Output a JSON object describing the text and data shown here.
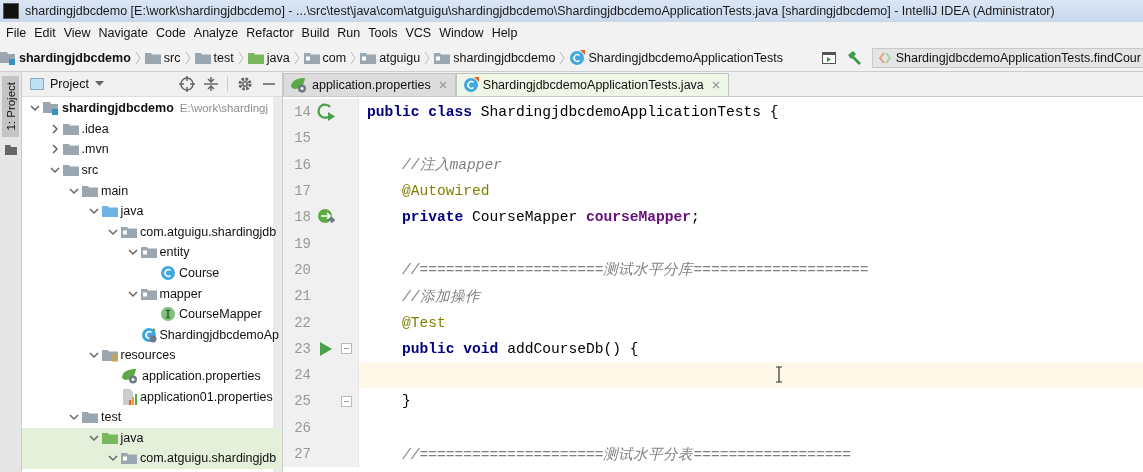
{
  "window": {
    "title": "shardingjdbcdemo [E:\\work\\shardingjdbcdemo] - ...\\src\\test\\java\\com\\atguigu\\shardingjdbcdemo\\ShardingjdbcdemoApplicationTests.java [shardingjdbcdemo] - IntelliJ IDEA (Administrator)"
  },
  "menu": [
    "File",
    "Edit",
    "View",
    "Navigate",
    "Code",
    "Analyze",
    "Refactor",
    "Build",
    "Run",
    "Tools",
    "VCS",
    "Window",
    "Help"
  ],
  "breadcrumbs": [
    {
      "label": "shardingjdbcdemo",
      "kind": "module"
    },
    {
      "label": "src",
      "kind": "folder"
    },
    {
      "label": "test",
      "kind": "folder"
    },
    {
      "label": "java",
      "kind": "test-root"
    },
    {
      "label": "com",
      "kind": "package"
    },
    {
      "label": "atguigu",
      "kind": "package"
    },
    {
      "label": "shardingjdbcdemo",
      "kind": "package"
    },
    {
      "label": "ShardingjdbcdemoApplicationTests",
      "kind": "test-class"
    }
  ],
  "run_config": {
    "label": "ShardingjdbcdemoApplicationTests.findCour"
  },
  "side_strip": {
    "label": "1: Project"
  },
  "project_panel": {
    "title": "Project",
    "tree": [
      {
        "label": "shardingjdbcdemo",
        "path": "E:\\work\\shardingj",
        "kind": "module",
        "expanded": true,
        "highlighted": false,
        "children": [
          {
            "label": ".idea",
            "kind": "folder",
            "expanded": false,
            "highlighted": false
          },
          {
            "label": ".mvn",
            "kind": "folder",
            "expanded": false,
            "highlighted": false
          },
          {
            "label": "src",
            "kind": "folder",
            "expanded": true,
            "highlighted": false,
            "children": [
              {
                "label": "main",
                "kind": "folder",
                "expanded": true,
                "highlighted": false,
                "children": [
                  {
                    "label": "java",
                    "kind": "source-root",
                    "expanded": true,
                    "highlighted": false,
                    "children": [
                      {
                        "label": "com.atguigu.shardingjdb",
                        "kind": "package",
                        "expanded": true,
                        "highlighted": false,
                        "children": [
                          {
                            "label": "entity",
                            "kind": "package",
                            "expanded": true,
                            "highlighted": false,
                            "children": [
                              {
                                "label": "Course",
                                "kind": "class",
                                "highlighted": false
                              }
                            ]
                          },
                          {
                            "label": "mapper",
                            "kind": "package",
                            "expanded": true,
                            "highlighted": false,
                            "children": [
                              {
                                "label": "CourseMapper",
                                "kind": "interface",
                                "highlighted": false
                              }
                            ]
                          },
                          {
                            "label": "ShardingjdbcdemoAp",
                            "kind": "spring-class",
                            "highlighted": false
                          }
                        ]
                      }
                    ]
                  },
                  {
                    "label": "resources",
                    "kind": "resources-root",
                    "expanded": true,
                    "highlighted": false,
                    "children": [
                      {
                        "label": "application.properties",
                        "kind": "spring-properties",
                        "highlighted": false
                      },
                      {
                        "label": "application01.properties",
                        "kind": "properties",
                        "highlighted": false
                      }
                    ]
                  }
                ]
              },
              {
                "label": "test",
                "kind": "folder",
                "expanded": true,
                "highlighted": false,
                "children": [
                  {
                    "label": "java",
                    "kind": "test-root",
                    "expanded": true,
                    "highlighted": true,
                    "children": [
                      {
                        "label": "com.atguigu.shardingjdb",
                        "kind": "package",
                        "expanded": true,
                        "highlighted": true
                      }
                    ]
                  }
                ]
              }
            ]
          }
        ]
      }
    ]
  },
  "editor": {
    "tabs": [
      {
        "label": "application.properties",
        "kind": "spring-properties",
        "selected": false
      },
      {
        "label": "ShardingjdbcdemoApplicationTests.java",
        "kind": "test-class",
        "selected": true
      }
    ],
    "lines": [
      {
        "number": "14",
        "kind": "run-class",
        "current": false,
        "tokens": [
          {
            "kind": "keyword",
            "text": "public class "
          },
          {
            "kind": "plain",
            "text": "ShardingjdbcdemoApplicationTests {"
          }
        ]
      },
      {
        "number": "15",
        "current": false
      },
      {
        "number": "16",
        "current": false,
        "tokens": [
          {
            "kind": "comment",
            "text": "    //注入mapper"
          }
        ]
      },
      {
        "number": "17",
        "current": false,
        "tokens": [
          {
            "kind": "annotation",
            "text": "    @Autowired"
          }
        ]
      },
      {
        "number": "18",
        "kind": "bean",
        "current": false,
        "tokens": [
          {
            "kind": "keyword",
            "text": "    private "
          },
          {
            "kind": "plain",
            "text": "CourseMapper "
          },
          {
            "kind": "field",
            "text": "courseMapper"
          },
          {
            "kind": "plain",
            "text": ";"
          }
        ]
      },
      {
        "number": "19",
        "current": false
      },
      {
        "number": "20",
        "current": false,
        "tokens": [
          {
            "kind": "comment",
            "text": "    //=====================测试水平分库===================="
          }
        ]
      },
      {
        "number": "21",
        "current": false,
        "tokens": [
          {
            "kind": "comment",
            "text": "    //添加操作"
          }
        ]
      },
      {
        "number": "22",
        "current": false,
        "tokens": [
          {
            "kind": "annotation",
            "text": "    @Test"
          }
        ]
      },
      {
        "number": "23",
        "kind": "run-method",
        "fold": true,
        "current": false,
        "tokens": [
          {
            "kind": "keyword",
            "text": "    public void "
          },
          {
            "kind": "plain",
            "text": "addCourseDb() {"
          }
        ]
      },
      {
        "number": "24",
        "current": true
      },
      {
        "number": "25",
        "fold": true,
        "current": false,
        "tokens": [
          {
            "kind": "plain",
            "text": "    }"
          }
        ]
      },
      {
        "number": "26",
        "current": false
      },
      {
        "number": "27",
        "current": false,
        "tokens": [
          {
            "kind": "comment",
            "text": "    //=====================测试水平分表=================="
          }
        ]
      }
    ]
  }
}
